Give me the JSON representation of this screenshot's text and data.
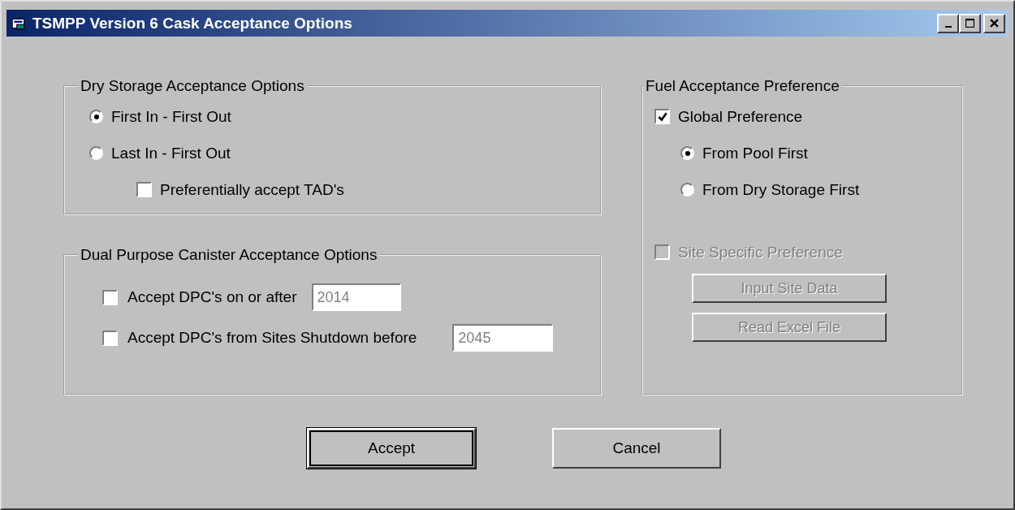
{
  "window": {
    "title": "TSMPP Version 6 Cask Acceptance Options"
  },
  "dry_storage": {
    "title": "Dry Storage Acceptance Options",
    "options": [
      {
        "label": "First In - First Out",
        "selected": true
      },
      {
        "label": "Last In - First Out",
        "selected": false
      }
    ],
    "tad": {
      "label": "Preferentially accept TAD's",
      "checked": false
    }
  },
  "dpc": {
    "title": "Dual Purpose Canister Acceptance Options",
    "rows": [
      {
        "label": "Accept DPC's on or after",
        "checked": false,
        "value": "2014",
        "disabled": true
      },
      {
        "label": "Accept DPC's from Sites Shutdown before",
        "checked": false,
        "value": "2045",
        "disabled": true
      }
    ]
  },
  "fuel": {
    "title": "Fuel Acceptance Preference",
    "global": {
      "label": "Global Preference",
      "checked": true
    },
    "options": [
      {
        "label": "From Pool First",
        "selected": true
      },
      {
        "label": "From Dry Storage First",
        "selected": false
      }
    ],
    "site": {
      "label": "Site Specific Preference",
      "checked": false,
      "disabled": true
    },
    "buttons": [
      {
        "label": "Input Site Data",
        "disabled": true
      },
      {
        "label": "Read Excel File",
        "disabled": true
      }
    ]
  },
  "buttons": [
    {
      "label": "Accept",
      "focused": true
    },
    {
      "label": "Cancel",
      "focused": false
    }
  ]
}
